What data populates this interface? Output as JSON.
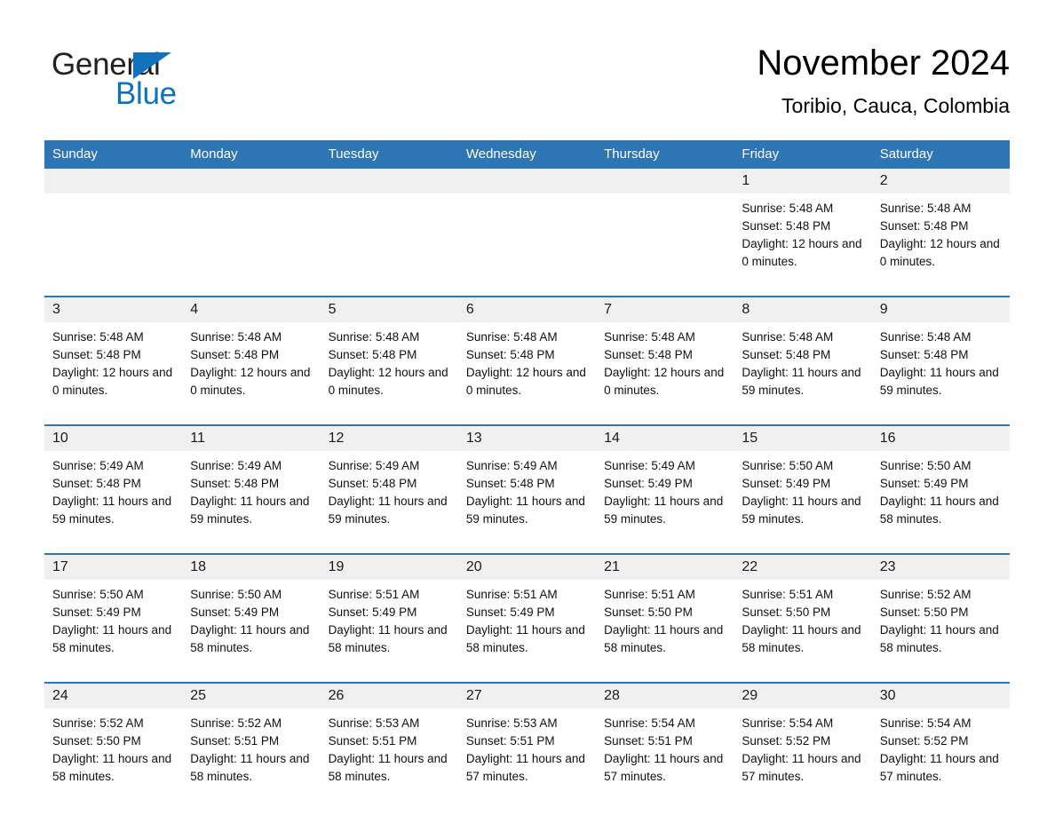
{
  "brand": {
    "name_part1": "General",
    "name_part2": "Blue",
    "triangle_color": "#1072bb"
  },
  "header": {
    "title": "November 2024",
    "location": "Toribio, Cauca, Colombia"
  },
  "theme": {
    "header_blue": "#2e75b6",
    "daynum_band": "#f0f0f0",
    "text": "#111111"
  },
  "calendar": {
    "weekday_headers": [
      "Sunday",
      "Monday",
      "Tuesday",
      "Wednesday",
      "Thursday",
      "Friday",
      "Saturday"
    ],
    "weeks": [
      {
        "days": [
          {
            "date": "",
            "lines": []
          },
          {
            "date": "",
            "lines": []
          },
          {
            "date": "",
            "lines": []
          },
          {
            "date": "",
            "lines": []
          },
          {
            "date": "",
            "lines": []
          },
          {
            "date": "1",
            "lines": [
              "Sunrise: 5:48 AM",
              "Sunset: 5:48 PM",
              "Daylight: 12 hours and 0 minutes."
            ]
          },
          {
            "date": "2",
            "lines": [
              "Sunrise: 5:48 AM",
              "Sunset: 5:48 PM",
              "Daylight: 12 hours and 0 minutes."
            ]
          }
        ]
      },
      {
        "days": [
          {
            "date": "3",
            "lines": [
              "Sunrise: 5:48 AM",
              "Sunset: 5:48 PM",
              "Daylight: 12 hours and 0 minutes."
            ]
          },
          {
            "date": "4",
            "lines": [
              "Sunrise: 5:48 AM",
              "Sunset: 5:48 PM",
              "Daylight: 12 hours and 0 minutes."
            ]
          },
          {
            "date": "5",
            "lines": [
              "Sunrise: 5:48 AM",
              "Sunset: 5:48 PM",
              "Daylight: 12 hours and 0 minutes."
            ]
          },
          {
            "date": "6",
            "lines": [
              "Sunrise: 5:48 AM",
              "Sunset: 5:48 PM",
              "Daylight: 12 hours and 0 minutes."
            ]
          },
          {
            "date": "7",
            "lines": [
              "Sunrise: 5:48 AM",
              "Sunset: 5:48 PM",
              "Daylight: 12 hours and 0 minutes."
            ]
          },
          {
            "date": "8",
            "lines": [
              "Sunrise: 5:48 AM",
              "Sunset: 5:48 PM",
              "Daylight: 11 hours and 59 minutes."
            ]
          },
          {
            "date": "9",
            "lines": [
              "Sunrise: 5:48 AM",
              "Sunset: 5:48 PM",
              "Daylight: 11 hours and 59 minutes."
            ]
          }
        ]
      },
      {
        "days": [
          {
            "date": "10",
            "lines": [
              "Sunrise: 5:49 AM",
              "Sunset: 5:48 PM",
              "Daylight: 11 hours and 59 minutes."
            ]
          },
          {
            "date": "11",
            "lines": [
              "Sunrise: 5:49 AM",
              "Sunset: 5:48 PM",
              "Daylight: 11 hours and 59 minutes."
            ]
          },
          {
            "date": "12",
            "lines": [
              "Sunrise: 5:49 AM",
              "Sunset: 5:48 PM",
              "Daylight: 11 hours and 59 minutes."
            ]
          },
          {
            "date": "13",
            "lines": [
              "Sunrise: 5:49 AM",
              "Sunset: 5:48 PM",
              "Daylight: 11 hours and 59 minutes."
            ]
          },
          {
            "date": "14",
            "lines": [
              "Sunrise: 5:49 AM",
              "Sunset: 5:49 PM",
              "Daylight: 11 hours and 59 minutes."
            ]
          },
          {
            "date": "15",
            "lines": [
              "Sunrise: 5:50 AM",
              "Sunset: 5:49 PM",
              "Daylight: 11 hours and 59 minutes."
            ]
          },
          {
            "date": "16",
            "lines": [
              "Sunrise: 5:50 AM",
              "Sunset: 5:49 PM",
              "Daylight: 11 hours and 58 minutes."
            ]
          }
        ]
      },
      {
        "days": [
          {
            "date": "17",
            "lines": [
              "Sunrise: 5:50 AM",
              "Sunset: 5:49 PM",
              "Daylight: 11 hours and 58 minutes."
            ]
          },
          {
            "date": "18",
            "lines": [
              "Sunrise: 5:50 AM",
              "Sunset: 5:49 PM",
              "Daylight: 11 hours and 58 minutes."
            ]
          },
          {
            "date": "19",
            "lines": [
              "Sunrise: 5:51 AM",
              "Sunset: 5:49 PM",
              "Daylight: 11 hours and 58 minutes."
            ]
          },
          {
            "date": "20",
            "lines": [
              "Sunrise: 5:51 AM",
              "Sunset: 5:49 PM",
              "Daylight: 11 hours and 58 minutes."
            ]
          },
          {
            "date": "21",
            "lines": [
              "Sunrise: 5:51 AM",
              "Sunset: 5:50 PM",
              "Daylight: 11 hours and 58 minutes."
            ]
          },
          {
            "date": "22",
            "lines": [
              "Sunrise: 5:51 AM",
              "Sunset: 5:50 PM",
              "Daylight: 11 hours and 58 minutes."
            ]
          },
          {
            "date": "23",
            "lines": [
              "Sunrise: 5:52 AM",
              "Sunset: 5:50 PM",
              "Daylight: 11 hours and 58 minutes."
            ]
          }
        ]
      },
      {
        "days": [
          {
            "date": "24",
            "lines": [
              "Sunrise: 5:52 AM",
              "Sunset: 5:50 PM",
              "Daylight: 11 hours and 58 minutes."
            ]
          },
          {
            "date": "25",
            "lines": [
              "Sunrise: 5:52 AM",
              "Sunset: 5:51 PM",
              "Daylight: 11 hours and 58 minutes."
            ]
          },
          {
            "date": "26",
            "lines": [
              "Sunrise: 5:53 AM",
              "Sunset: 5:51 PM",
              "Daylight: 11 hours and 58 minutes."
            ]
          },
          {
            "date": "27",
            "lines": [
              "Sunrise: 5:53 AM",
              "Sunset: 5:51 PM",
              "Daylight: 11 hours and 57 minutes."
            ]
          },
          {
            "date": "28",
            "lines": [
              "Sunrise: 5:54 AM",
              "Sunset: 5:51 PM",
              "Daylight: 11 hours and 57 minutes."
            ]
          },
          {
            "date": "29",
            "lines": [
              "Sunrise: 5:54 AM",
              "Sunset: 5:52 PM",
              "Daylight: 11 hours and 57 minutes."
            ]
          },
          {
            "date": "30",
            "lines": [
              "Sunrise: 5:54 AM",
              "Sunset: 5:52 PM",
              "Daylight: 11 hours and 57 minutes."
            ]
          }
        ]
      }
    ]
  }
}
